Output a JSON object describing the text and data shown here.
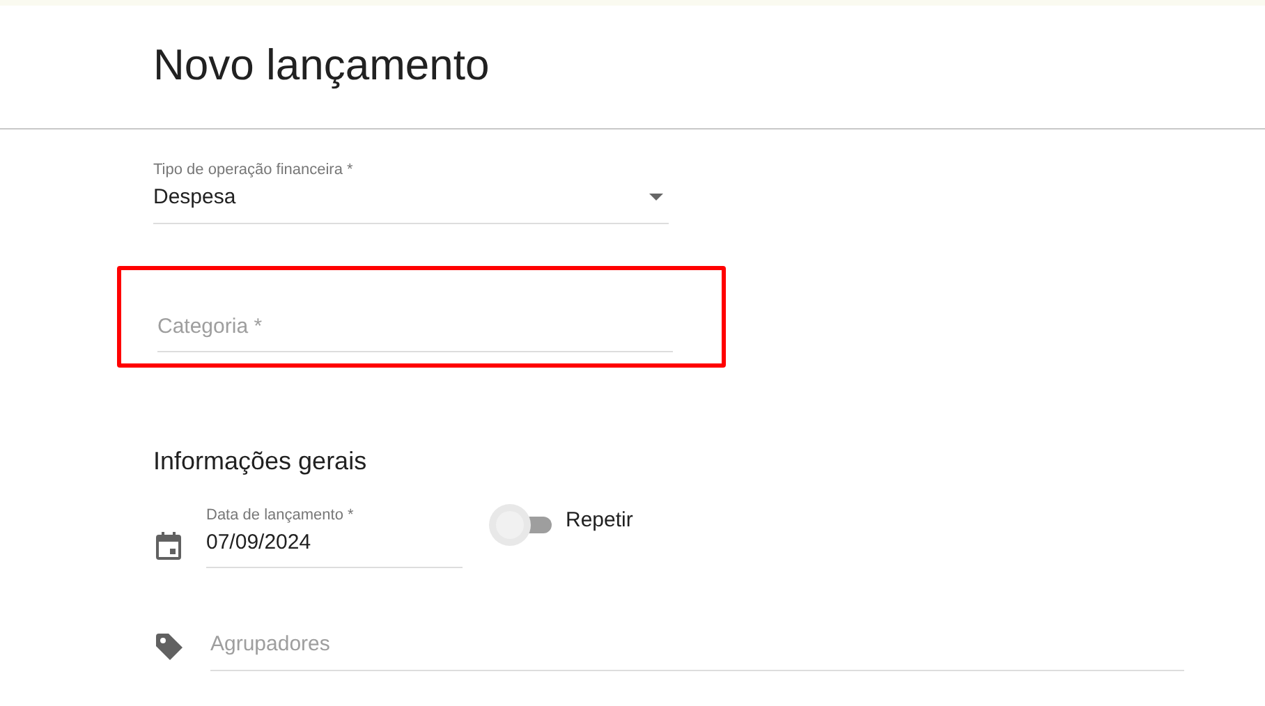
{
  "page": {
    "title": "Novo lançamento"
  },
  "operation_type": {
    "label": "Tipo de operação financeira *",
    "value": "Despesa"
  },
  "category": {
    "placeholder": "Categoria *",
    "highlighted": true
  },
  "section": {
    "title": "Informações gerais"
  },
  "launch_date": {
    "label": "Data de lançamento *",
    "value": "07/09/2024"
  },
  "repeat": {
    "label": "Repetir",
    "on": false
  },
  "groupers": {
    "placeholder": "Agrupadores"
  }
}
